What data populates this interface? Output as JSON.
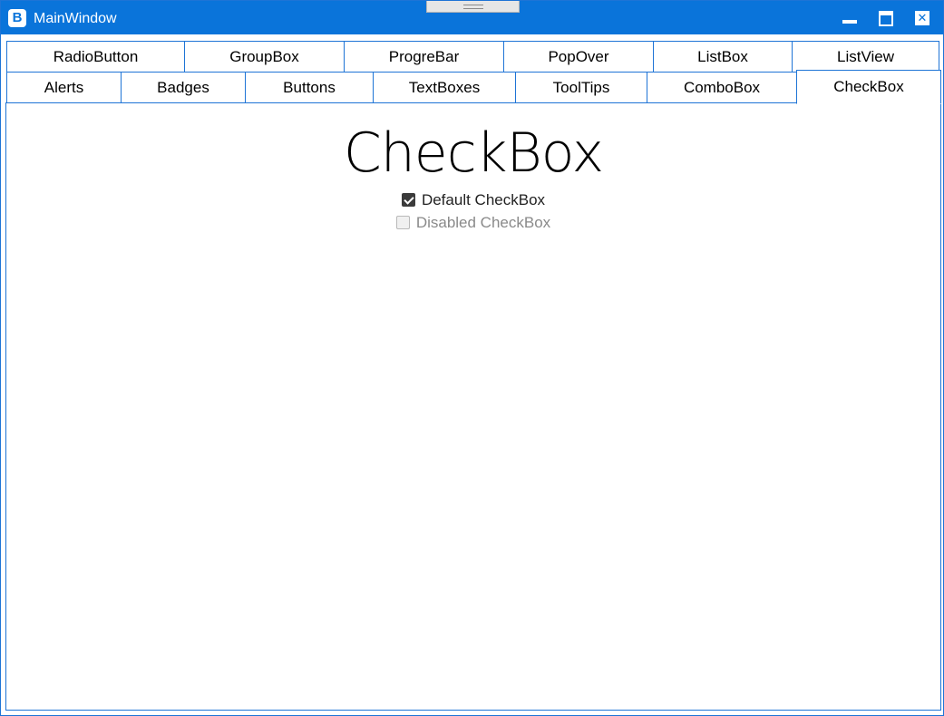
{
  "window": {
    "title": "MainWindow",
    "app_icon_letter": "B"
  },
  "tabs_row1": [
    "RadioButton",
    "GroupBox",
    "ProgreBar",
    "PopOver",
    "ListBox",
    "ListView"
  ],
  "tabs_row2": [
    "Alerts",
    "Badges",
    "Buttons",
    "TextBoxes",
    "ToolTips",
    "ComboBox",
    "CheckBox"
  ],
  "active_tab": "CheckBox",
  "content": {
    "heading": "CheckBox",
    "checkboxes": [
      {
        "label": "Default CheckBox",
        "checked": true,
        "enabled": true
      },
      {
        "label": "Disabled CheckBox",
        "checked": false,
        "enabled": false
      }
    ]
  },
  "colors": {
    "accent": "#0a74da",
    "border": "#1e74d6"
  }
}
